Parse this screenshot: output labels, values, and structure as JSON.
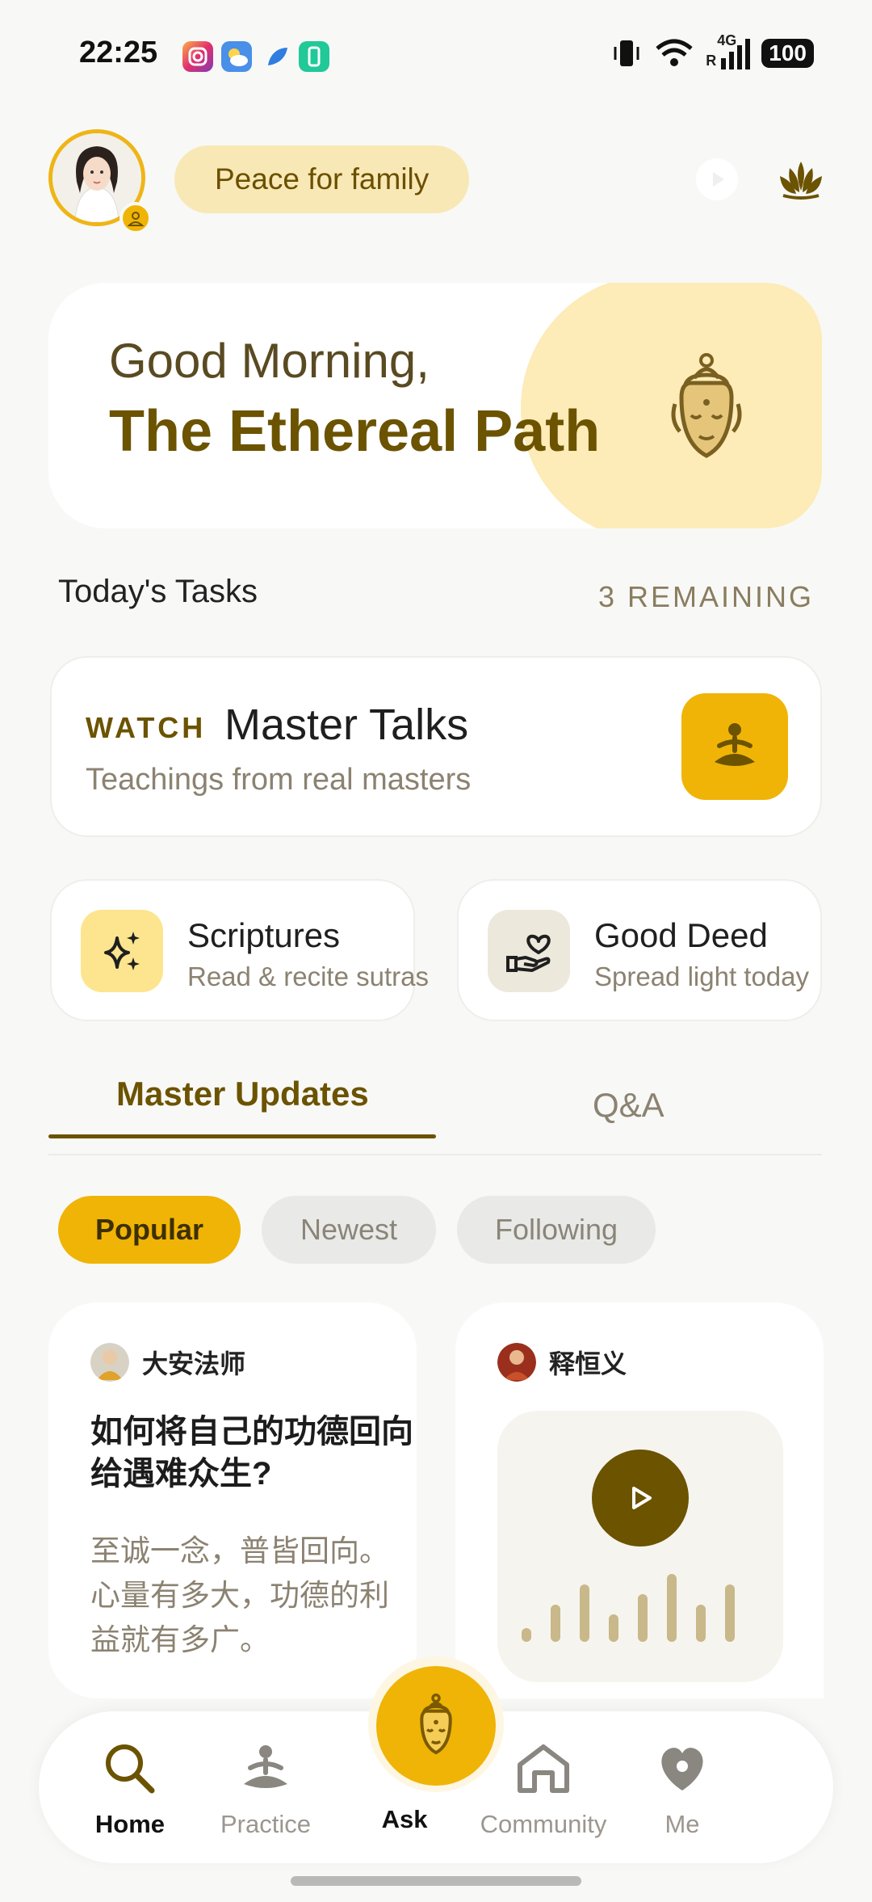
{
  "status_bar": {
    "time": "22:25",
    "battery": "100",
    "network": "4G",
    "roaming": "R"
  },
  "header": {
    "pill_label": "Peace for family",
    "icons": [
      "avatar",
      "person-badge-icon",
      "play-icon",
      "lotus-icon"
    ]
  },
  "greeting": {
    "line1": "Good Morning,",
    "line2": "The Ethereal Path",
    "icon": "buddha-head-icon"
  },
  "tasks": {
    "title": "Today's Tasks",
    "remaining": "3 REMAINING",
    "featured": {
      "keyword": "WATCH",
      "title": "Master Talks",
      "subtitle": "Teachings from real masters",
      "icon": "meditation-icon"
    },
    "cards": [
      {
        "title": "Scriptures",
        "subtitle": "Read & recite sutras",
        "icon": "sparkle-icon",
        "color": "#fde58f"
      },
      {
        "title": "Good Deed",
        "subtitle": "Spread light today",
        "icon": "heart-hand-icon",
        "color": "#ece8dc"
      }
    ]
  },
  "tabs": [
    {
      "label": "Master Updates",
      "active": true
    },
    {
      "label": "Q&A",
      "active": false
    }
  ],
  "filters": [
    {
      "label": "Popular",
      "active": true
    },
    {
      "label": "Newest",
      "active": false
    },
    {
      "label": "Following",
      "active": false
    }
  ],
  "posts": [
    {
      "author": "大安法师",
      "title": "如何将自己的功德回向给遇难众生?",
      "body": "至诚一念，普皆回向。心量有多大，功德的利益就有多广。"
    },
    {
      "author": "释恒义",
      "type": "audio",
      "waveform": [
        0.2,
        0.55,
        0.85,
        0.4,
        0.7,
        1.0,
        0.55,
        0.85
      ]
    }
  ],
  "bottom_nav": {
    "items": [
      {
        "label": "Home",
        "icon": "search-icon",
        "active": true
      },
      {
        "label": "Practice",
        "icon": "meditation-icon",
        "active": false
      },
      {
        "label": "Ask",
        "icon": "buddha-head-icon",
        "active": true
      },
      {
        "label": "Community",
        "icon": "temple-icon",
        "active": false
      },
      {
        "label": "Me",
        "icon": "heart-icon",
        "active": false
      }
    ]
  },
  "colors": {
    "accent": "#f0b407",
    "brand_dark": "#6b5300",
    "muted": "#8b8271",
    "background": "#f8f8f7"
  }
}
